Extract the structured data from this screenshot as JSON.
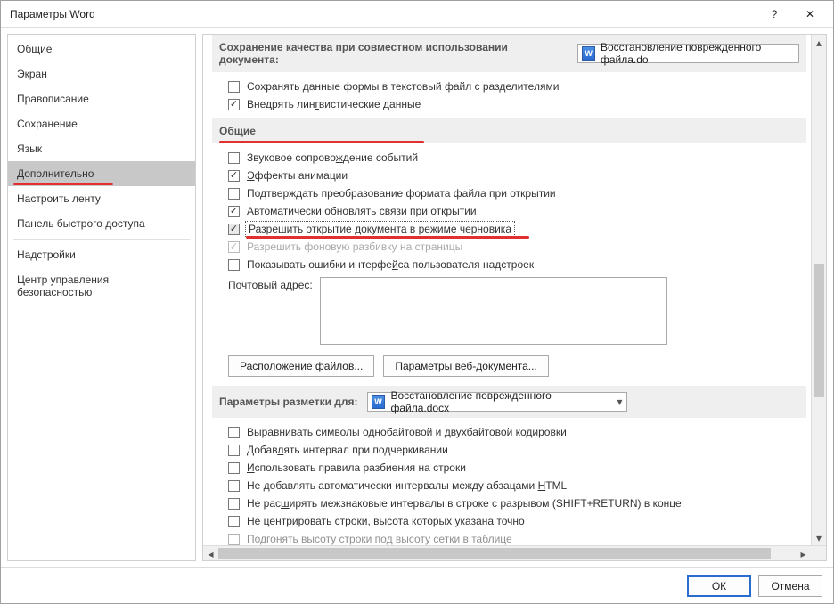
{
  "window": {
    "title": "Параметры Word"
  },
  "titlebar": {
    "help": "?",
    "close": "✕"
  },
  "sidebar": {
    "items": [
      {
        "label": "Общие"
      },
      {
        "label": "Экран"
      },
      {
        "label": "Правописание"
      },
      {
        "label": "Сохранение"
      },
      {
        "label": "Язык"
      },
      {
        "label": "Дополнительно",
        "selected": true,
        "red": true
      },
      {
        "label": "Настроить ленту"
      },
      {
        "label": "Панель быстрого доступа"
      },
      {
        "label": "Надстройки"
      },
      {
        "label": "Центр управления безопасностью"
      }
    ]
  },
  "content": {
    "quality": {
      "heading": "Сохранение качества при совместном использовании документа:",
      "doc": "Восстановление поврежденного файла.do",
      "opt_form": "Сохранять данные формы в текстовый файл с разделителями",
      "opt_ling": "Внедрять лингвистические данные"
    },
    "general": {
      "heading": "Общие",
      "opt_sound": "Звуковое сопровождение событий",
      "opt_anim": "Эффекты анимации",
      "opt_confirm": "Подтверждать преобразование формата файла при открытии",
      "opt_autolinks": "Автоматически обновлять связи при открытии",
      "opt_draft": "Разрешить открытие документа в режиме черновика",
      "opt_bgpag": "Разрешить фоновую разбивку на страницы",
      "opt_errors": "Показывать ошибки интерфейса пользователя надстроек",
      "mail_label": "Почтовый адрес:",
      "btn_files": "Расположение файлов...",
      "btn_webdoc": "Параметры веб-документа..."
    },
    "layoutfor": {
      "heading": "Параметры разметки для:",
      "doc": "Восстановление поврежденного файла.docx",
      "opt_align": "Выравнивать символы однобайтовой и двухбайтовой кодировки",
      "opt_underline": "Добавлять интервал при подчеркивании",
      "opt_linebreak": "Использовать правила разбиения на строки",
      "opt_html": "Не добавлять автоматически интервалы между абзацами HTML",
      "opt_shift": "Не расширять межзнаковые интервалы в строке с разрывом (SHIFT+RETURN) в конце",
      "opt_center": "Не центрировать строки, высота которых указана точно",
      "opt_grid": "Подгонять высоту строки под высоту сетки в таблице"
    }
  },
  "footer": {
    "ok": "ОК",
    "cancel": "Отмена"
  }
}
